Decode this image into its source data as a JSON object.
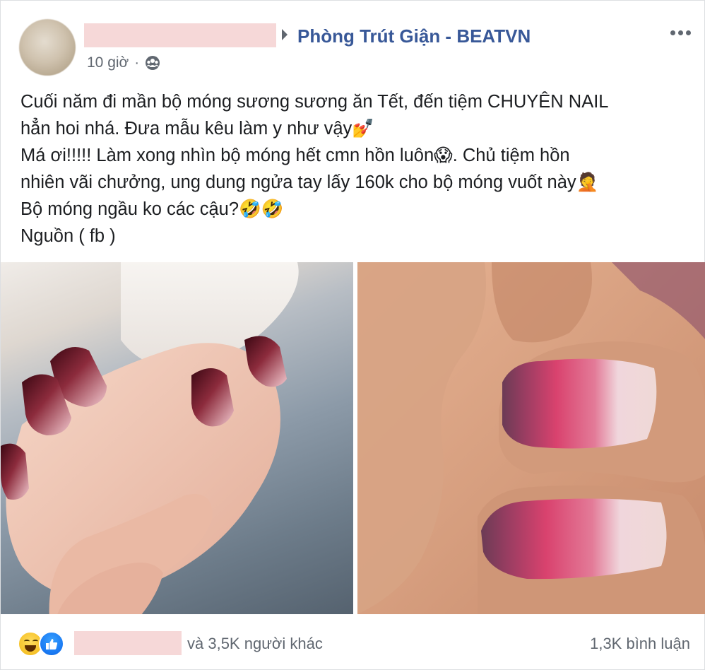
{
  "post": {
    "group_name": "Phòng Trút Giận - BEATVN",
    "timestamp": "10 giờ",
    "separator": "·",
    "privacy_icon": "group-icon",
    "lines": [
      "Cuối năm đi mần bộ móng sương sương ăn Tết, đến tiệm CHUYÊN NAIL",
      "hẳn hoi nhá. Đưa mẫu kêu làm y như vậy💅",
      "Má ơi!!!!! Làm xong nhìn bộ móng hết cmn hồn luôn😱. Chủ tiệm hồn",
      "nhiên vãi chưởng, ung dung ngửa tay lấy 160k cho bộ móng vuốt này🤦",
      "Bộ móng ngầu ko các cậu?🤣🤣",
      "Nguồn ( fb )"
    ]
  },
  "footer": {
    "reaction_icons": [
      "haha-icon",
      "like-icon"
    ],
    "reactors_text": "và 3,5K người khác",
    "comments_text": "1,3K bình luận"
  },
  "colors": {
    "link": "#385898",
    "secondary_text": "#606770",
    "redaction": "#f6d8d8",
    "like_blue": "#1877f2"
  }
}
